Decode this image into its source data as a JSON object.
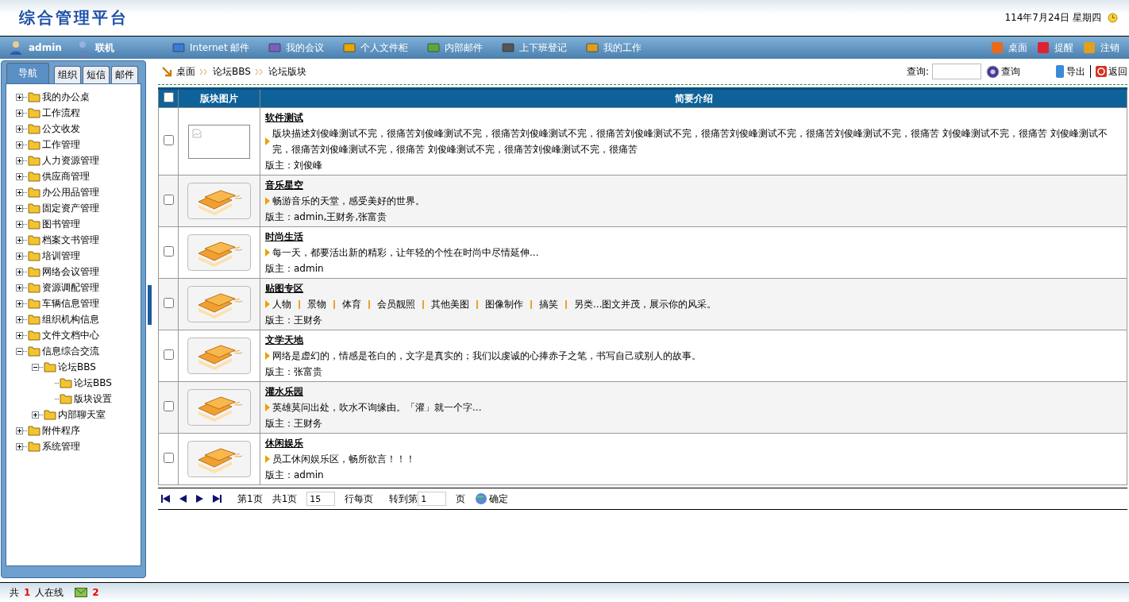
{
  "header": {
    "title": "综合管理平台",
    "date": "114年7月24日  星期四"
  },
  "navbar": {
    "user": "admin",
    "status": "联机",
    "links": [
      {
        "label": "Internet 邮件"
      },
      {
        "label": "我的会议"
      },
      {
        "label": "个人文件柜"
      },
      {
        "label": "内部邮件"
      },
      {
        "label": "上下班登记"
      },
      {
        "label": "我的工作"
      }
    ],
    "right_links": [
      {
        "label": "桌面"
      },
      {
        "label": "提醒"
      },
      {
        "label": "注销"
      }
    ]
  },
  "sidebar": {
    "tabs": [
      {
        "label": "导航",
        "selected": true
      },
      {
        "label": "组织",
        "selected": false
      },
      {
        "label": "短信",
        "selected": false
      },
      {
        "label": "邮件",
        "selected": false
      }
    ],
    "tree": [
      {
        "label": "我的办公桌",
        "expanded": false
      },
      {
        "label": "工作流程",
        "expanded": false
      },
      {
        "label": "公文收发",
        "expanded": false
      },
      {
        "label": "工作管理",
        "expanded": false
      },
      {
        "label": "人力资源管理",
        "expanded": false
      },
      {
        "label": "供应商管理",
        "expanded": false
      },
      {
        "label": "办公用品管理",
        "expanded": false
      },
      {
        "label": "固定资产管理",
        "expanded": false
      },
      {
        "label": "图书管理",
        "expanded": false
      },
      {
        "label": "档案文书管理",
        "expanded": false
      },
      {
        "label": "培训管理",
        "expanded": false
      },
      {
        "label": "网络会议管理",
        "expanded": false
      },
      {
        "label": "资源调配管理",
        "expanded": false
      },
      {
        "label": "车辆信息管理",
        "expanded": false
      },
      {
        "label": "组织机构信息",
        "expanded": false
      },
      {
        "label": "文件文档中心",
        "expanded": false
      },
      {
        "label": "信息综合交流",
        "expanded": true,
        "children": [
          {
            "label": "论坛BBS",
            "expanded": true,
            "children": [
              {
                "label": "论坛BBS"
              },
              {
                "label": "版块设置"
              }
            ]
          },
          {
            "label": "内部聊天室",
            "expanded": false
          }
        ]
      },
      {
        "label": "附件程序",
        "expanded": false
      },
      {
        "label": "系统管理",
        "expanded": false
      }
    ]
  },
  "breadcrumb": [
    "桌面",
    "论坛BBS",
    "论坛版块"
  ],
  "toolbar": {
    "search_label": "查询:",
    "search_button": "查询",
    "export": "导出",
    "back": "返回"
  },
  "table": {
    "select_all": {
      "checked": false
    },
    "columns": [
      "版块图片",
      "简要介绍"
    ],
    "rows": [
      {
        "checked": false,
        "kind": "no-image",
        "name": "软件测试",
        "description": "版块描述刘俊峰测试不完，很痛苦刘俊峰测试不完，很痛苦刘俊峰测试不完，很痛苦刘俊峰测试不完，很痛苦刘俊峰测试不完，很痛苦刘俊峰测试不完，很痛苦 刘俊峰测试不完，很痛苦 刘俊峰测试不完，很痛苦刘俊峰测试不完，很痛苦 刘俊峰测试不完，很痛苦刘俊峰测试不完，很痛苦",
        "moderator": "版主：刘俊峰"
      },
      {
        "checked": false,
        "kind": "books",
        "name": "音乐星空",
        "description": "畅游音乐的天堂，感受美好的世界。",
        "moderator": "版主：admin,王财务,张富贵"
      },
      {
        "checked": false,
        "kind": "books",
        "name": "时尚生活",
        "description": "每一天，都要活出新的精彩，让年轻的个性在时尚中尽情延伸...",
        "moderator": "版主：admin"
      },
      {
        "checked": false,
        "kind": "books",
        "name": "贴图专区",
        "tags": [
          "人物",
          "景物",
          "体育",
          "会员靓照",
          "其他美图",
          "图像制作",
          "搞笑",
          "另类"
        ],
        "description": "...图文并茂，展示你的风采。",
        "moderator": "版主：王财务"
      },
      {
        "checked": false,
        "kind": "books",
        "name": "文学天地",
        "description": "网络是虚幻的，情感是苍白的，文字是真实的；我们以虔诚的心捧赤子之笔，书写自己或别人的故事。",
        "moderator": "版主：张富贵"
      },
      {
        "checked": false,
        "kind": "books",
        "name": "灌水乐园",
        "description": "英雄莫问出处，吹水不询缘由。「灌」就一个字...",
        "moderator": "版主：王财务"
      },
      {
        "checked": false,
        "kind": "books",
        "name": "休闲娱乐",
        "description": "员工休闲娱乐区，畅所欲言！！！",
        "moderator": "版主：admin"
      }
    ]
  },
  "pager": {
    "current": "第1页",
    "total": "共1页",
    "page_size": "15",
    "page_size_label": "行每页",
    "goto_label": "转到第",
    "goto_value": "1",
    "goto_suffix": "页",
    "confirm": "确定"
  },
  "status_bar": {
    "prefix": "共",
    "online_count": "1",
    "suffix": "人在线",
    "mail_count": "2"
  }
}
